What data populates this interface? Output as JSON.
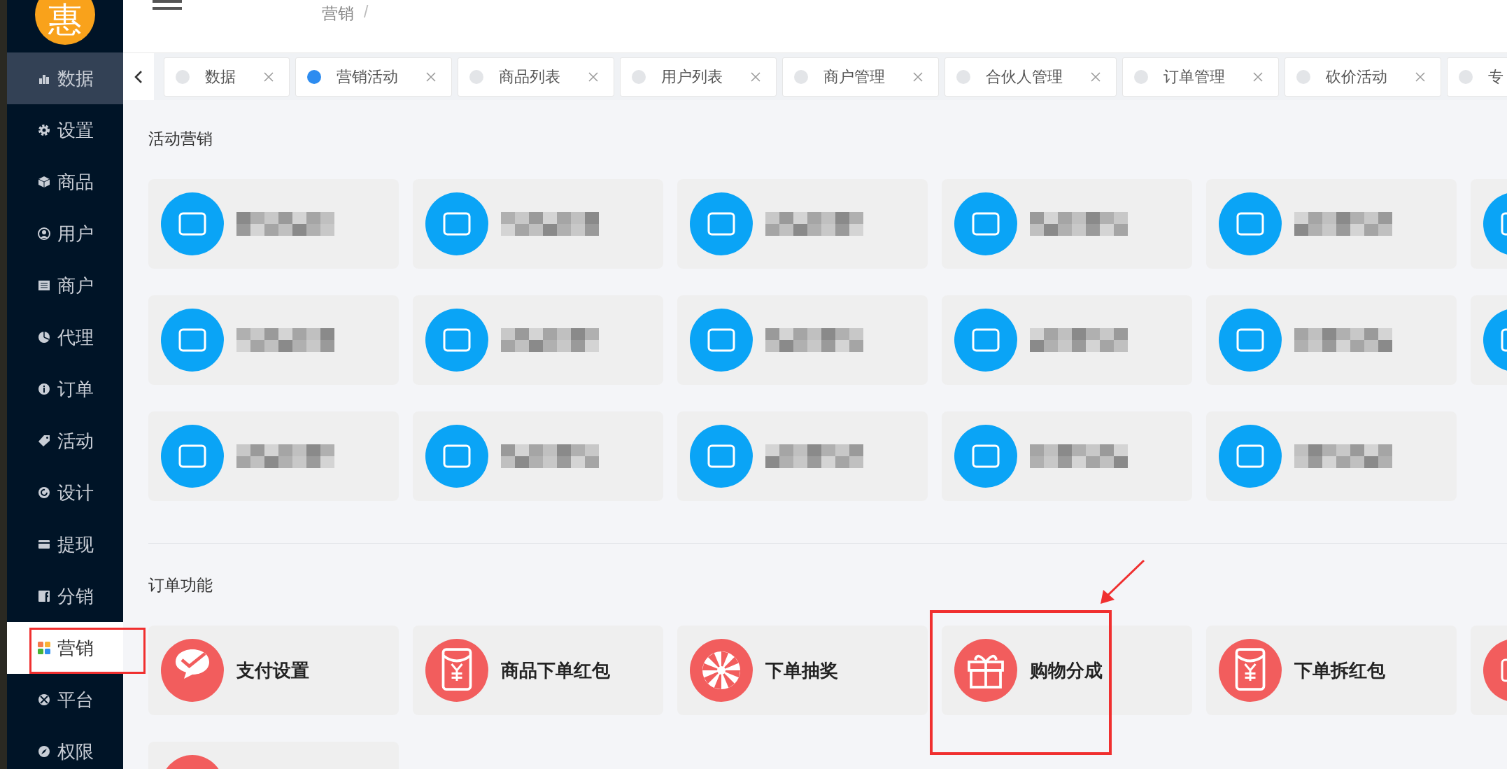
{
  "sidebar": {
    "logo": "惠",
    "items": [
      {
        "label": "数据",
        "hovered": true,
        "selected": false,
        "annotated": false
      },
      {
        "label": "设置",
        "hovered": false,
        "selected": false,
        "annotated": false
      },
      {
        "label": "商品",
        "hovered": false,
        "selected": false,
        "annotated": false
      },
      {
        "label": "用户",
        "hovered": false,
        "selected": false,
        "annotated": false
      },
      {
        "label": "商户",
        "hovered": false,
        "selected": false,
        "annotated": false
      },
      {
        "label": "代理",
        "hovered": false,
        "selected": false,
        "annotated": false
      },
      {
        "label": "订单",
        "hovered": false,
        "selected": false,
        "annotated": false
      },
      {
        "label": "活动",
        "hovered": false,
        "selected": false,
        "annotated": false
      },
      {
        "label": "设计",
        "hovered": false,
        "selected": false,
        "annotated": false
      },
      {
        "label": "提现",
        "hovered": false,
        "selected": false,
        "annotated": false
      },
      {
        "label": "分销",
        "hovered": false,
        "selected": false,
        "annotated": false
      },
      {
        "label": "营销",
        "hovered": false,
        "selected": true,
        "annotated": true
      },
      {
        "label": "平台",
        "hovered": false,
        "selected": false,
        "annotated": false
      },
      {
        "label": "权限",
        "hovered": false,
        "selected": false,
        "annotated": false
      }
    ]
  },
  "header": {
    "breadcrumb": "营销",
    "separator": "/"
  },
  "tabs": [
    {
      "label": "数据",
      "selected": false
    },
    {
      "label": "营销活动",
      "selected": true
    },
    {
      "label": "商品列表",
      "selected": false
    },
    {
      "label": "用户列表",
      "selected": false
    },
    {
      "label": "商户管理",
      "selected": false
    },
    {
      "label": "合伙人管理",
      "selected": false
    },
    {
      "label": "订单管理",
      "selected": false
    },
    {
      "label": "砍价活动",
      "selected": false
    },
    {
      "label": "专",
      "selected": false
    }
  ],
  "sections": [
    {
      "title": "活动营销",
      "color": "#0aa4f6",
      "rows": [
        [
          {
            "kind": "blurred"
          },
          {
            "kind": "blurred"
          },
          {
            "kind": "blurred"
          },
          {
            "kind": "blurred"
          },
          {
            "kind": "blurred"
          },
          {
            "kind": "blurred"
          }
        ],
        [
          {
            "kind": "blurred"
          },
          {
            "kind": "blurred"
          },
          {
            "kind": "blurred"
          },
          {
            "kind": "blurred"
          },
          {
            "kind": "blurred"
          },
          {
            "kind": "blurred"
          }
        ],
        [
          {
            "kind": "blurred"
          },
          {
            "kind": "blurred"
          },
          {
            "kind": "blurred"
          },
          {
            "kind": "blurred"
          },
          {
            "kind": "blurred"
          }
        ]
      ]
    },
    {
      "title": "订单功能",
      "color": "#f25d5d",
      "rows": [
        [
          {
            "kind": "item",
            "label": "支付设置",
            "annotated": false
          },
          {
            "kind": "item",
            "label": "商品下单红包",
            "annotated": false
          },
          {
            "kind": "item",
            "label": "下单抽奖",
            "annotated": false
          },
          {
            "kind": "item",
            "label": "购物分成",
            "annotated": true
          },
          {
            "kind": "item",
            "label": "下单拆红包",
            "annotated": false
          },
          {
            "kind": "blurred"
          }
        ],
        [
          {
            "kind": "blurred"
          }
        ]
      ]
    }
  ]
}
